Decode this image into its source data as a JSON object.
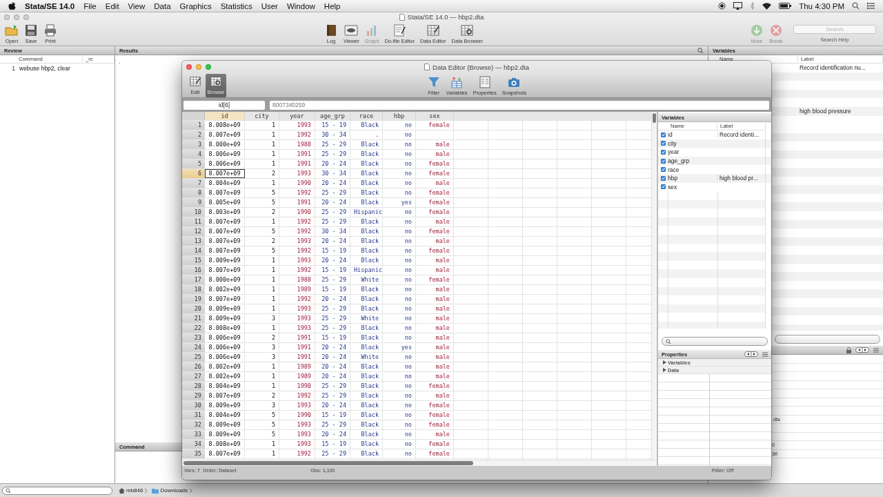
{
  "menu_bar": {
    "app": "Stata/SE 14.0",
    "items": [
      "File",
      "Edit",
      "View",
      "Data",
      "Graphics",
      "Statistics",
      "User",
      "Window",
      "Help"
    ],
    "clock": "Thu 4:30 PM"
  },
  "window": {
    "title": "Stata/SE 14.0 — hbp2.dta",
    "toolbar_left": [
      {
        "label": "Open",
        "kind": "open",
        "disabled": false
      },
      {
        "label": "Save",
        "kind": "save",
        "disabled": false
      },
      {
        "label": "Print",
        "kind": "print",
        "disabled": false
      }
    ],
    "toolbar_center": [
      {
        "label": "Log",
        "kind": "log",
        "disabled": false
      },
      {
        "label": "Viewer",
        "kind": "viewer",
        "disabled": false
      },
      {
        "label": "Graph",
        "kind": "graph",
        "disabled": true
      },
      {
        "label": "Do-file Editor",
        "kind": "dofile",
        "disabled": false
      },
      {
        "label": "Data Editor",
        "kind": "editor",
        "disabled": false
      },
      {
        "label": "Data Browser",
        "kind": "browser",
        "disabled": false
      }
    ],
    "toolbar_right": [
      {
        "label": "More",
        "kind": "more",
        "disabled": true
      },
      {
        "label": "Break",
        "kind": "break",
        "disabled": true
      }
    ],
    "search": {
      "placeholder": "Search",
      "caption": "Search Help"
    }
  },
  "review": {
    "title": "Review",
    "columns": [
      "Command",
      "_rc"
    ],
    "rows": [
      {
        "number": "1",
        "command": "webuse hbp2, clear"
      }
    ]
  },
  "results": {
    "title": "Results",
    "lines": [
      "."
    ]
  },
  "command": {
    "title": "Command"
  },
  "variables": {
    "title": "Variables",
    "columns": [
      "Name",
      "Label"
    ],
    "rows": [
      {
        "label": "Record identification nu..."
      },
      {},
      {},
      {},
      {},
      {
        "label": "high blood pressure"
      },
      {}
    ]
  },
  "properties": {
    "rows": [
      {},
      {},
      {},
      {},
      {},
      {},
      {},
      {
        "value": ".dta"
      },
      {},
      {},
      {
        "value": "0"
      },
      {
        "value": "3K"
      }
    ]
  },
  "path_bar": [
    "mb846",
    "Downloads"
  ],
  "data_editor": {
    "title": "Data Editor (Browse) — hbp2.dta",
    "modes": [
      {
        "label": "Edit",
        "selected": false
      },
      {
        "label": "Browse",
        "selected": true
      }
    ],
    "tools": [
      {
        "label": "Filter",
        "kind": "filter"
      },
      {
        "label": "Variables",
        "kind": "variables"
      },
      {
        "label": "Properties",
        "kind": "properties"
      },
      {
        "label": "Snapshots",
        "kind": "snapshots"
      }
    ],
    "cell_name": "id[6]",
    "cell_value": "8007340259",
    "columns": [
      {
        "name": "id",
        "kind": "numeric",
        "selected": true
      },
      {
        "name": "city",
        "kind": "numeric",
        "selected": false
      },
      {
        "name": "year",
        "kind": "string",
        "selected": false
      },
      {
        "name": "age_grp",
        "kind": "labeled",
        "selected": false
      },
      {
        "name": "race",
        "kind": "labeled",
        "selected": false
      },
      {
        "name": "hbp",
        "kind": "labeled",
        "selected": false
      },
      {
        "name": "sex",
        "kind": "string",
        "selected": false
      }
    ],
    "rows": [
      {
        "number": "1",
        "selected": false,
        "cells": [
          "8.008e+09",
          "1",
          "1993",
          "15 - 19",
          "Black",
          "no",
          "female"
        ]
      },
      {
        "number": "2",
        "selected": false,
        "cells": [
          "8.007e+09",
          "1",
          "1992",
          "30 - 34",
          ".",
          "no",
          null
        ]
      },
      {
        "number": "3",
        "selected": false,
        "cells": [
          "8.000e+09",
          "1",
          "1988",
          "25 - 29",
          "Black",
          "no",
          "male"
        ]
      },
      {
        "number": "4",
        "selected": false,
        "cells": [
          "8.006e+09",
          "1",
          "1991",
          "25 - 29",
          "Black",
          "no",
          "male"
        ]
      },
      {
        "number": "5",
        "selected": false,
        "cells": [
          "8.006e+09",
          "1",
          "1991",
          "20 - 24",
          "Black",
          "no",
          "female"
        ]
      },
      {
        "number": "6",
        "selected": true,
        "cells": [
          "8.007e+09",
          "2",
          "1993",
          "30 - 34",
          "Black",
          "no",
          "female"
        ]
      },
      {
        "number": "7",
        "selected": false,
        "cells": [
          "8.004e+09",
          "1",
          "1990",
          "20 - 24",
          "Black",
          "no",
          "male"
        ]
      },
      {
        "number": "8",
        "selected": false,
        "cells": [
          "8.007e+09",
          "5",
          "1992",
          "25 - 29",
          "Black",
          "no",
          "female"
        ]
      },
      {
        "number": "9",
        "selected": false,
        "cells": [
          "8.005e+09",
          "5",
          "1991",
          "20 - 24",
          "Black",
          "yes",
          "female"
        ]
      },
      {
        "number": "10",
        "selected": false,
        "cells": [
          "8.003e+09",
          "2",
          "1990",
          "25 - 29",
          "Hispanic",
          "no",
          "female"
        ]
      },
      {
        "number": "11",
        "selected": false,
        "cells": [
          "8.007e+09",
          "1",
          "1992",
          "25 - 29",
          "Black",
          "no",
          "male"
        ]
      },
      {
        "number": "12",
        "selected": false,
        "cells": [
          "8.007e+09",
          "5",
          "1992",
          "30 - 34",
          "Black",
          "no",
          "female"
        ]
      },
      {
        "number": "13",
        "selected": false,
        "cells": [
          "8.007e+09",
          "2",
          "1993",
          "20 - 24",
          "Black",
          "no",
          "male"
        ]
      },
      {
        "number": "14",
        "selected": false,
        "cells": [
          "8.007e+09",
          "5",
          "1992",
          "15 - 19",
          "Black",
          "no",
          "female"
        ]
      },
      {
        "number": "15",
        "selected": false,
        "cells": [
          "8.009e+09",
          "1",
          "1993",
          "20 - 24",
          "Black",
          "no",
          "male"
        ]
      },
      {
        "number": "16",
        "selected": false,
        "cells": [
          "8.007e+09",
          "1",
          "1992",
          "15 - 19",
          "Hispanic",
          "no",
          "male"
        ]
      },
      {
        "number": "17",
        "selected": false,
        "cells": [
          "8.000e+09",
          "1",
          "1988",
          "25 - 29",
          "White",
          "no",
          "female"
        ]
      },
      {
        "number": "18",
        "selected": false,
        "cells": [
          "8.002e+09",
          "1",
          "1989",
          "15 - 19",
          "Black",
          "no",
          "male"
        ]
      },
      {
        "number": "19",
        "selected": false,
        "cells": [
          "8.007e+09",
          "1",
          "1992",
          "20 - 24",
          "Black",
          "no",
          "male"
        ]
      },
      {
        "number": "20",
        "selected": false,
        "cells": [
          "8.009e+09",
          "1",
          "1993",
          "25 - 29",
          "Black",
          "no",
          "male"
        ]
      },
      {
        "number": "21",
        "selected": false,
        "cells": [
          "8.009e+09",
          "3",
          "1993",
          "25 - 29",
          "White",
          "no",
          "male"
        ]
      },
      {
        "number": "22",
        "selected": false,
        "cells": [
          "8.008e+09",
          "1",
          "1993",
          "25 - 29",
          "Black",
          "no",
          "male"
        ]
      },
      {
        "number": "23",
        "selected": false,
        "cells": [
          "8.006e+09",
          "2",
          "1991",
          "15 - 19",
          "Black",
          "no",
          "male"
        ]
      },
      {
        "number": "24",
        "selected": false,
        "cells": [
          "8.006e+09",
          "3",
          "1991",
          "20 - 24",
          "Black",
          "yes",
          "male"
        ]
      },
      {
        "number": "25",
        "selected": false,
        "cells": [
          "8.006e+09",
          "3",
          "1991",
          "20 - 24",
          "White",
          "no",
          "male"
        ]
      },
      {
        "number": "26",
        "selected": false,
        "cells": [
          "8.002e+09",
          "1",
          "1989",
          "20 - 24",
          "Black",
          "no",
          "male"
        ]
      },
      {
        "number": "27",
        "selected": false,
        "cells": [
          "8.002e+09",
          "1",
          "1989",
          "20 - 24",
          "Black",
          "no",
          "male"
        ]
      },
      {
        "number": "28",
        "selected": false,
        "cells": [
          "8.004e+09",
          "1",
          "1990",
          "25 - 29",
          "Black",
          "no",
          "female"
        ]
      },
      {
        "number": "29",
        "selected": false,
        "cells": [
          "8.007e+09",
          "2",
          "1992",
          "25 - 29",
          "Black",
          "no",
          "male"
        ]
      },
      {
        "number": "30",
        "selected": false,
        "cells": [
          "8.009e+09",
          "3",
          "1993",
          "20 - 24",
          "Black",
          "no",
          "female"
        ]
      },
      {
        "number": "31",
        "selected": false,
        "cells": [
          "8.004e+09",
          "5",
          "1990",
          "15 - 19",
          "Black",
          "no",
          "female"
        ]
      },
      {
        "number": "32",
        "selected": false,
        "cells": [
          "8.009e+09",
          "5",
          "1993",
          "25 - 29",
          "Black",
          "no",
          "female"
        ]
      },
      {
        "number": "33",
        "selected": false,
        "cells": [
          "8.009e+09",
          "5",
          "1993",
          "20 - 24",
          "Black",
          "no",
          "male"
        ]
      },
      {
        "number": "34",
        "selected": false,
        "cells": [
          "8.008e+09",
          "1",
          "1993",
          "15 - 19",
          "Black",
          "no",
          "female"
        ]
      },
      {
        "number": "35",
        "selected": false,
        "cells": [
          "8.007e+09",
          "1",
          "1992",
          "25 - 29",
          "Black",
          "no",
          "female"
        ]
      }
    ],
    "variables_pane": {
      "title": "Variables",
      "columns": [
        "Name",
        "Label"
      ],
      "items": [
        {
          "name": "id",
          "label": "Record identi...",
          "checked": true
        },
        {
          "name": "city",
          "checked": true
        },
        {
          "name": "year",
          "checked": true
        },
        {
          "name": "age_grp",
          "checked": true
        },
        {
          "name": "race",
          "checked": true
        },
        {
          "name": "hbp",
          "label": "high blood pr...",
          "checked": true
        },
        {
          "name": "sex",
          "checked": true
        }
      ]
    },
    "properties_pane": {
      "title": "Properties",
      "sections": [
        {
          "label": "Variables",
          "expanded": false
        },
        {
          "label": "Data",
          "expanded": false
        }
      ]
    },
    "status": {
      "vars": "Vars: 7",
      "order": "Order: Dataset",
      "obs": "Obs: 1,130",
      "filter": "Filter: Off"
    }
  }
}
